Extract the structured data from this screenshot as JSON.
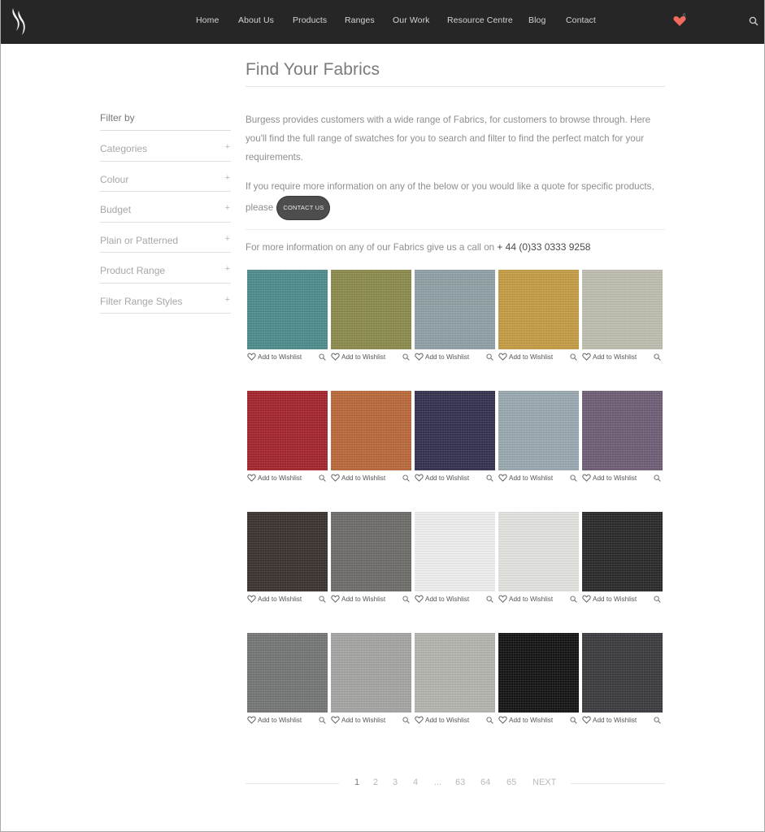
{
  "header": {
    "logo": "burgess-logo",
    "nav": [
      "Home",
      "About Us",
      "Products",
      "Ranges",
      "Our Work",
      "Resource Centre",
      "Blog",
      "Contact"
    ],
    "wishlist_count": "0",
    "colors": {
      "bar": "#262626",
      "heart": "#f06a5e"
    }
  },
  "sidebar": {
    "heading": "Filter by",
    "filters": [
      {
        "label": "Categories",
        "icon": "+"
      },
      {
        "label": "Colour",
        "icon": "+"
      },
      {
        "label": "Budget",
        "icon": "+"
      },
      {
        "label": "Plain or Patterned",
        "icon": "+"
      },
      {
        "label": "Product Range",
        "icon": "+"
      },
      {
        "label": "Filter Range Styles",
        "icon": "+"
      }
    ]
  },
  "main": {
    "title": "Find Your Fabrics",
    "intro": "Burgess provides customers with a wide range of Fabrics, for customers to browse through. Here you'll find the full range of swatches for you to search and filter to find the perfect match for your requirements.",
    "request_text": "If you require more information on any of the below or you would like a quote for specific products, please",
    "contact_button": "CONTACT US",
    "call_text": "For more information on any of our Fabrics give us a call on",
    "phone": "+ 44 (0)33 0333 9258"
  },
  "swatches": {
    "wishlist_label": "Add to Wishlist",
    "rows": [
      [
        "#4f8b8c",
        "#8a8a4d",
        "#8e9fa3",
        "#c29b44",
        "#bdbcae"
      ],
      [
        "#a3262d",
        "#b8683a",
        "#34324f",
        "#99a7ae",
        "#6e5e75"
      ],
      [
        "#3a3330",
        "#6e6c69",
        "#ececec",
        "#e0e0dc",
        "#2a2a2b"
      ],
      [
        "#747575",
        "#a3a3a1",
        "#b3b3ad",
        "#151515",
        "#3c3c40"
      ]
    ]
  },
  "pagination": {
    "pages": [
      "1",
      "2",
      "3",
      "4",
      "...",
      "63",
      "64",
      "65",
      "NEXT"
    ],
    "current": "1"
  }
}
